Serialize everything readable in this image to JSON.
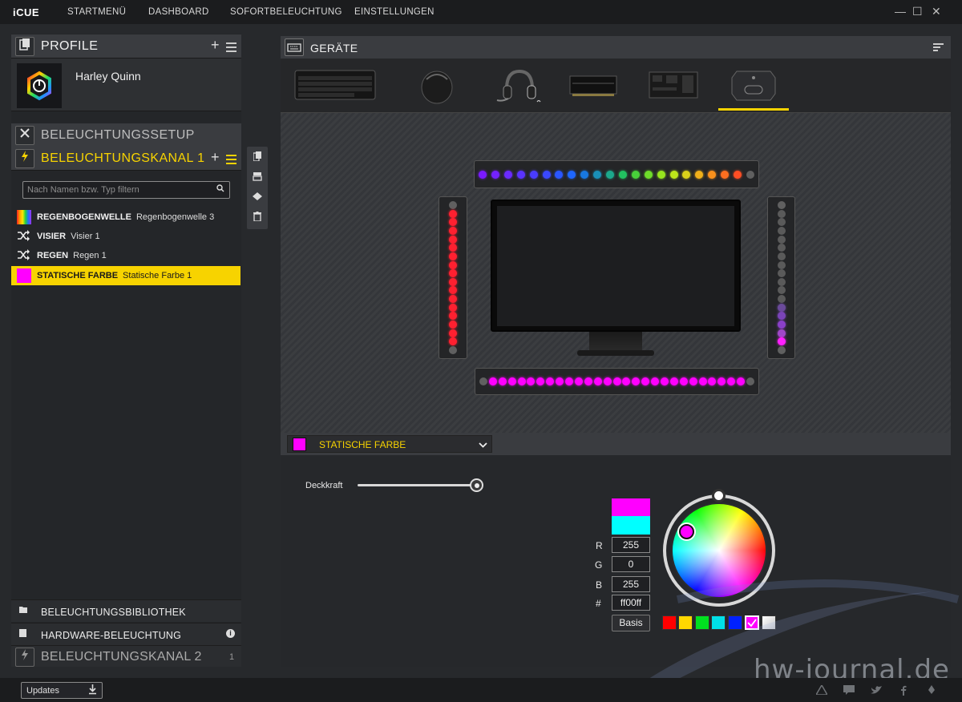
{
  "app": {
    "logo": "iCUE"
  },
  "nav": [
    "STARTMENÜ",
    "DASHBOARD",
    "SOFORTBELEUCHTUNG",
    "EINSTELLUNGEN"
  ],
  "window_controls": {
    "minimize": "—",
    "maximize": "☐",
    "close": "✕"
  },
  "profiles": {
    "title": "PROFILE",
    "add": "+",
    "active_profile": "Harley Quinn"
  },
  "lighting_setup": {
    "title": "BELEUCHTUNGSSETUP"
  },
  "channel1": {
    "title": "BELEUCHTUNGSKANAL 1",
    "add": "+"
  },
  "search": {
    "placeholder": "Nach Namen bzw. Typ filtern",
    "icon": "search-icon"
  },
  "layers": [
    {
      "name": "REGENBOGENWELLE",
      "sub": "Regenbogenwelle 3",
      "icon": "rainbow-icon",
      "selected": false
    },
    {
      "name": "VISIER",
      "sub": "Visier 1",
      "icon": "shuffle-icon",
      "selected": false
    },
    {
      "name": "REGEN",
      "sub": "Regen 1",
      "icon": "shuffle-icon",
      "selected": false
    },
    {
      "name": "STATISCHE FARBE",
      "sub": "Statische Farbe 1",
      "icon": "color-swatch-icon",
      "selected": true
    }
  ],
  "bottom_sections": {
    "library": "BELEUCHTUNGSBIBLIOTHEK",
    "hardware": "HARDWARE-BELEUCHTUNG",
    "hardware_info": "i",
    "channel2": "BELEUCHTUNGSKANAL 2",
    "channel2_count": "1"
  },
  "devices_panel": {
    "title": "GERÄTE"
  },
  "devices": [
    "keyboard",
    "mouse",
    "headset",
    "memory",
    "motherboard",
    "lighting-node"
  ],
  "effect": {
    "name": "STATISCHE FARBE",
    "color": "#ff00ff"
  },
  "opacity": {
    "label": "Deckkraft",
    "value": 1.0
  },
  "color": {
    "r_label": "R",
    "g_label": "G",
    "b_label": "B",
    "hex_label": "#",
    "r": "255",
    "g": "0",
    "b": "255",
    "hex": "ff00ff",
    "new_color": "#ff00ff",
    "old_color": "#00ffff",
    "basis_button": "Basis",
    "swatches": [
      "#ff0000",
      "#ffd800",
      "#00e020",
      "#00e0e8",
      "#0020ff",
      "#ff00ff",
      "#e8e8e8"
    ]
  },
  "led_colors": {
    "top": [
      "#7a1aff",
      "#7422ff",
      "#6a2aff",
      "#5a33ff",
      "#4a3cff",
      "#3a48ff",
      "#2a56ff",
      "#1e66ff",
      "#1878e0",
      "#1a90b8",
      "#1ca88c",
      "#22c060",
      "#48d03a",
      "#6edc2a",
      "#96e41e",
      "#bce61a",
      "#dad21a",
      "#f0b01a",
      "#f8901c",
      "#fc6e20",
      "#fe4e24",
      "#606060"
    ],
    "left": [
      "#606060",
      "#ff2030",
      "#ff2030",
      "#ff2030",
      "#ff2030",
      "#ff2030",
      "#ff2030",
      "#ff2030",
      "#ff2030",
      "#ff2030",
      "#ff2030",
      "#ff2030",
      "#ff2030",
      "#ff2030",
      "#ff2030",
      "#ff2030",
      "#ff2030",
      "#606060"
    ],
    "right": [
      "#606060",
      "#5a5a5a",
      "#5a5a5a",
      "#5a5a5a",
      "#5a5a5a",
      "#5a5a5a",
      "#5a5a5a",
      "#5a5a5a",
      "#5a5a5a",
      "#5a5a5a",
      "#5a5a5a",
      "#5a5a5a",
      "#6a4a9a",
      "#7a44b8",
      "#8a40c8",
      "#a048c8",
      "#ff20ff",
      "#606060"
    ],
    "bottom": [
      "#606060",
      "#ff00ff",
      "#ff00ff",
      "#ff00ff",
      "#ff00ff",
      "#ff00ff",
      "#ff00ff",
      "#ff00ff",
      "#ff00ff",
      "#ff00ff",
      "#ff00ff",
      "#ff00ff",
      "#ff00ff",
      "#ff00ff",
      "#ff00ff",
      "#ff00ff",
      "#ff00ff",
      "#ff00ff",
      "#ff00ff",
      "#ff00ff",
      "#ff00ff",
      "#ff00ff",
      "#ff00ff",
      "#ff00ff",
      "#ff00ff",
      "#ff00ff",
      "#ff00ff",
      "#ff00ff",
      "#606060"
    ]
  },
  "footer": {
    "updates": "Updates"
  },
  "watermark": "hw-journal.de",
  "accent": "#f7d300"
}
